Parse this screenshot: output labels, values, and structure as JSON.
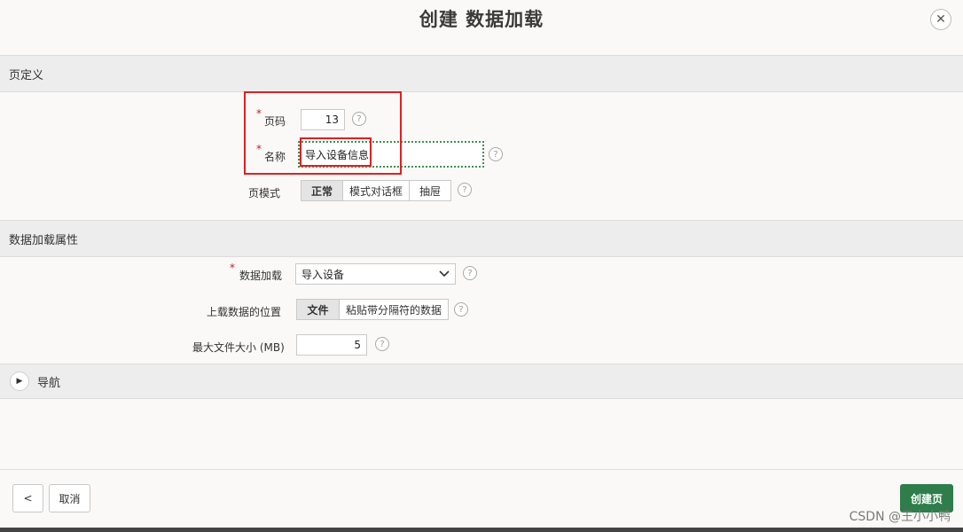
{
  "dialog": {
    "title": "创建 数据加载",
    "close_symbol": "✕"
  },
  "page_definition": {
    "section_title": "页定义",
    "required_mark": "*",
    "page_number": {
      "label": "页码",
      "value": "13"
    },
    "name": {
      "label": "名称",
      "value": "导入设备信息"
    },
    "page_mode": {
      "label": "页模式",
      "options": [
        "正常",
        "模式对话框",
        "抽屉"
      ],
      "selected": "正常"
    },
    "help_symbol": "?"
  },
  "data_load_attributes": {
    "section_title": "数据加载属性",
    "data_load": {
      "label": "数据加载",
      "value": "导入设备"
    },
    "upload_location": {
      "label": "上载数据的位置",
      "options": [
        "文件",
        "粘贴带分隔符的数据"
      ],
      "selected": "文件"
    },
    "max_file_size": {
      "label": "最大文件大小 (MB)",
      "value": "5"
    }
  },
  "navigation": {
    "label": "导航"
  },
  "footer": {
    "back_symbol": "<",
    "cancel_label": "取消",
    "create_label": "创建页"
  },
  "watermark": "CSDN @王小小鸭",
  "colors": {
    "primary_button": "#2e7d4b",
    "annotation_red": "#e02020",
    "focus_green": "#3e8f52"
  },
  "icons": [
    "close-icon",
    "help-icon",
    "chevron-down-icon",
    "triangle-right-icon",
    "chevron-left-icon"
  ]
}
